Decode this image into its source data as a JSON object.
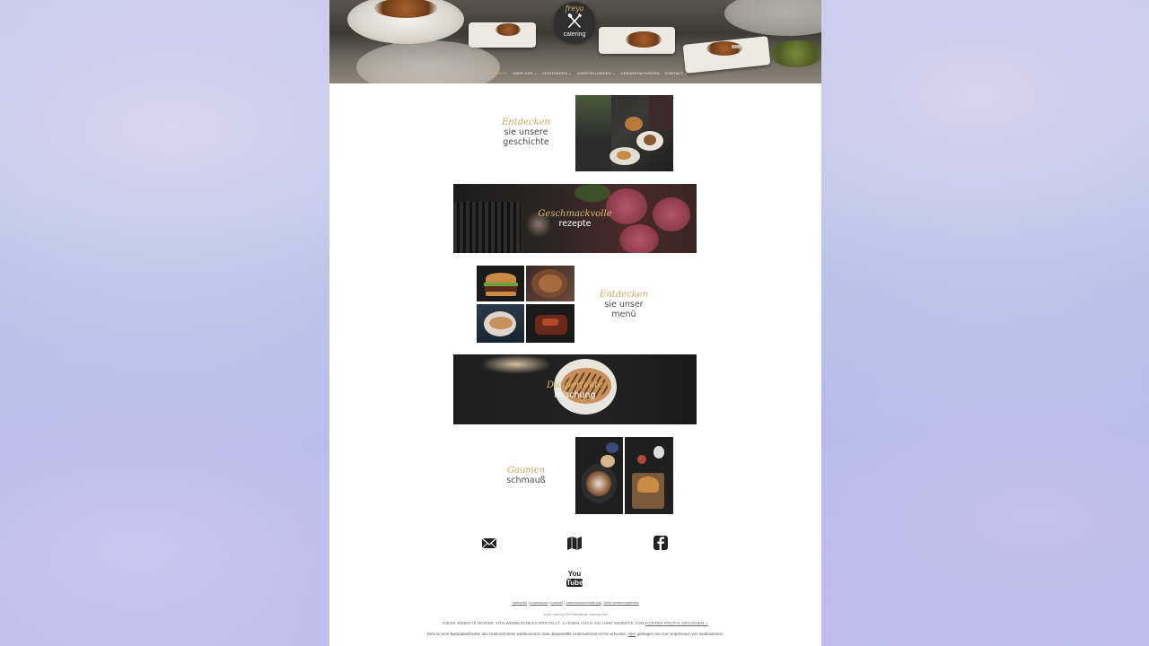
{
  "brand": {
    "script": "freya",
    "name": "catering"
  },
  "nav": {
    "items": [
      {
        "label": "Startseite",
        "caret": ""
      },
      {
        "label": "Über uns",
        "caret": "⌄"
      },
      {
        "label": "Leistungen",
        "caret": "⌄"
      },
      {
        "label": "Vorstellungen",
        "caret": "⌄"
      },
      {
        "label": "Veranstaltungen",
        "caret": ""
      },
      {
        "label": "Kontakt",
        "caret": "⌄"
      }
    ],
    "active_index": 0
  },
  "sections": {
    "story": {
      "script": "Entdecken",
      "line1": "sie unsere",
      "line2": "geschichte"
    },
    "recipes": {
      "script": "Geschmackvolle",
      "line1": "rezepte"
    },
    "menu": {
      "script": "Entdecken",
      "line1": "sie unser",
      "line2": "menü"
    },
    "mix": {
      "script": "Die perfekte",
      "line1": "mischung"
    },
    "taste": {
      "script": "Gaumen",
      "line1": "schmauß"
    }
  },
  "social": {
    "icons": [
      "email-icon",
      "map-icon",
      "facebook-icon",
      "youtube-icon"
    ],
    "youtube_top": "You",
    "youtube_bottom": "Tube"
  },
  "footer": {
    "links": [
      "Startseite",
      "Impressum",
      "Kontakt",
      "Datenschutzerklärung",
      "Seite weiterempfehlen"
    ],
    "copyright": "od by Catering 2019 Webdesign Catering Web",
    "made_text": "DIESE WEBSITE WURDE VON WEBBUSINESS ERSTELLT. LASSEN AUCH SIE IHRE WEBSITE VON",
    "made_link": "ECHTEN PROFIS DESIGNEN »",
    "note": "Dies ist eine Beispielwebseite des Unternehmens webbusiness. Das dargestellte Unternehmen ist frei erfunden.",
    "note_link": "Hier",
    "note_end": "gelangen Sie zum Impressum von webbusiness."
  },
  "colors": {
    "accent": "#c9a55c",
    "logo_bg": "#2f2f30",
    "text": "#4a4a4a"
  }
}
